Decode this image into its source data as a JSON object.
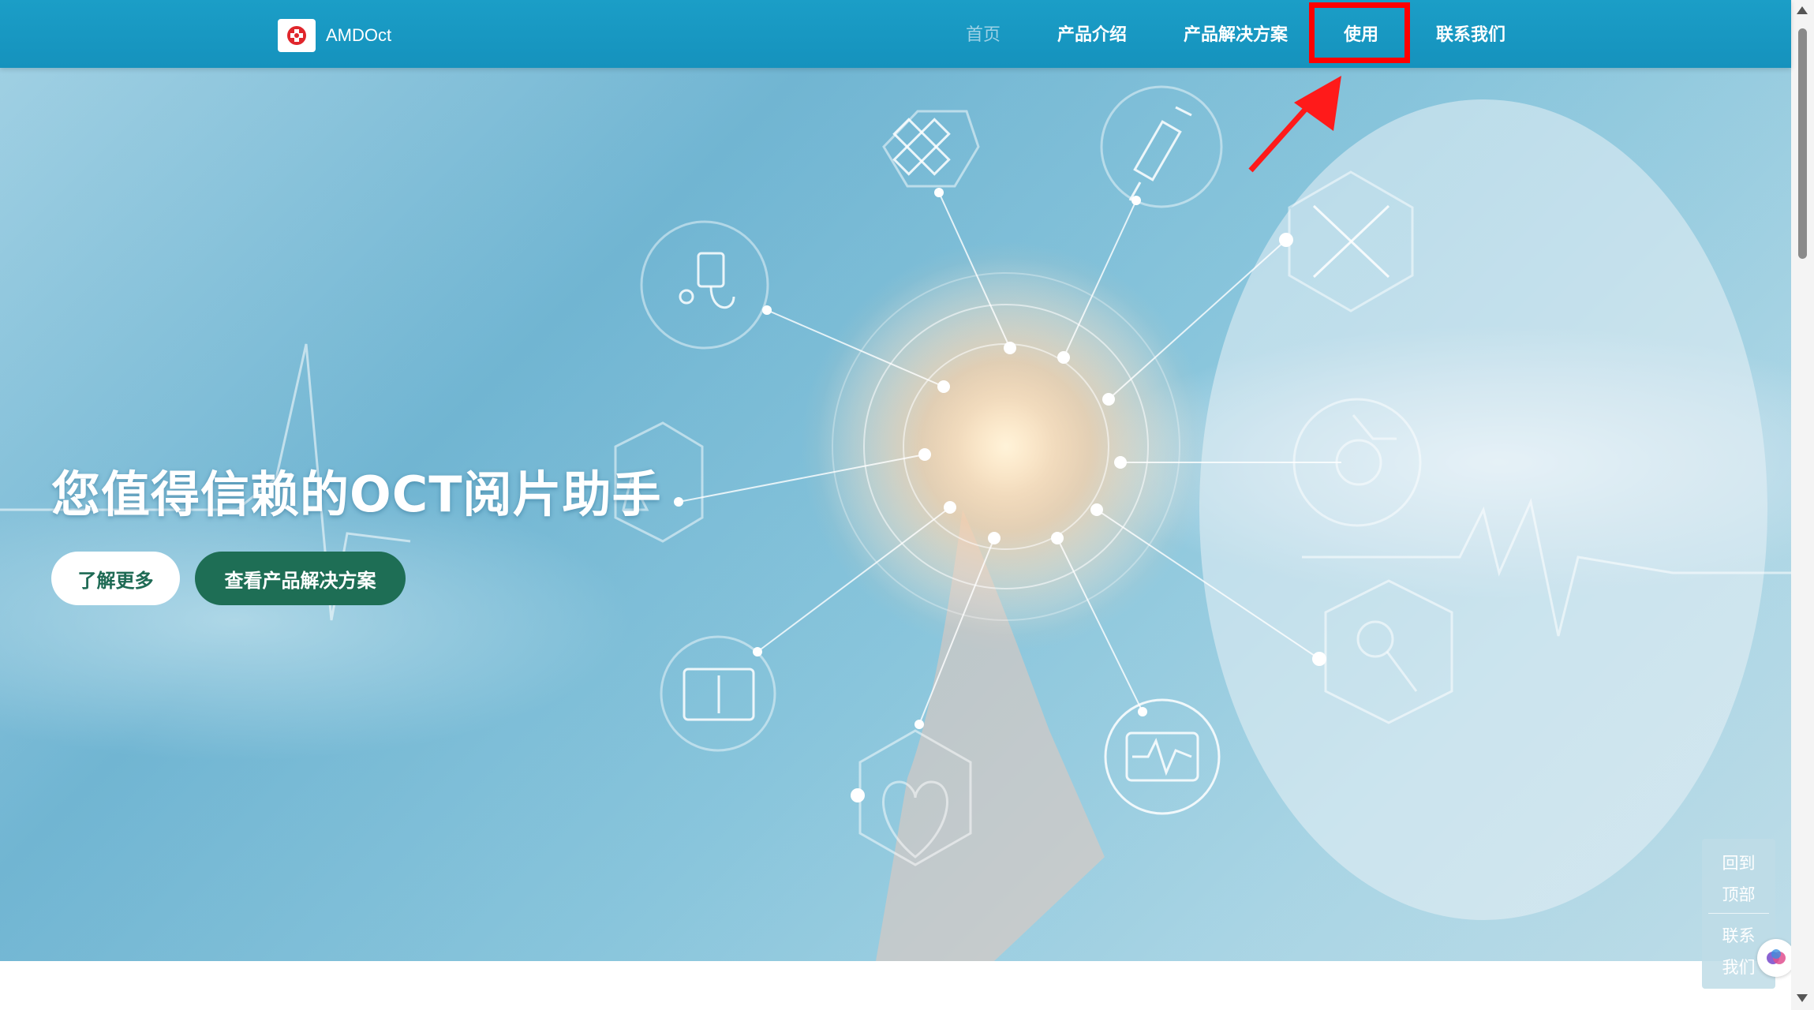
{
  "header": {
    "brand_name": "AMDOct",
    "nav": [
      {
        "label": "首页",
        "active": true
      },
      {
        "label": "产品介绍",
        "active": false
      },
      {
        "label": "产品解决方案",
        "active": false
      },
      {
        "label": "使用",
        "active": false
      },
      {
        "label": "联系我们",
        "active": false
      }
    ]
  },
  "hero": {
    "title": "您值得信赖的OCT阅片助手",
    "buttons": {
      "learn_more": "了解更多",
      "view_solutions": "查看产品解决方案"
    }
  },
  "float_panel": {
    "back_to_top_line1": "回到",
    "back_to_top_line2": "顶部",
    "contact_line1": "联系",
    "contact_line2": "我们"
  },
  "colors": {
    "nav_bg": "#1b9ec7",
    "highlight": "#ff0000",
    "button_green": "#1e6e55"
  },
  "icons": [
    "bandage-icon",
    "syringe-icon",
    "iv-drip-icon",
    "crossed-crutches-icon",
    "wheelchair-icon",
    "microscope-icon",
    "magnifier-icon",
    "xray-icon",
    "heart-icon",
    "heart-monitor-icon",
    "arrow-annotation"
  ]
}
